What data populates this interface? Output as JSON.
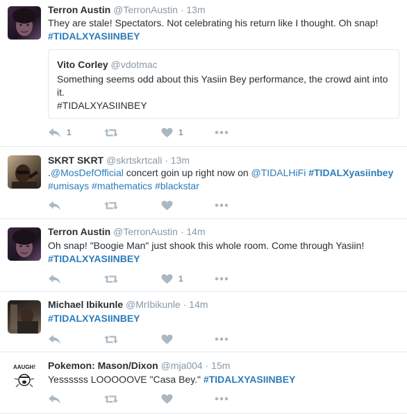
{
  "tweets": [
    {
      "name": "Terron Austin",
      "handle": "@TerronAustin",
      "sep": "·",
      "time": "13m",
      "text": "They are stale! Spectators. Not celebrating his return like I thought. Oh snap!",
      "hashtag": "#TIDALXYASIINBEY",
      "quote": {
        "name": "Vito Corley",
        "handle": "@vdotmac",
        "line1": "Something seems odd about this Yasiin Bey performance, the crowd aint into it.",
        "line2": "#TIDALXYASIINBEY"
      },
      "retweet_count": "1",
      "like_count": "1"
    },
    {
      "name": "SKRT SKRT",
      "handle": "@skrtskrtcali",
      "sep": "·",
      "time": "13m",
      "text_pre": ".",
      "mention1": "@MosDefOfficial",
      "text_mid": " concert goin up right now on ",
      "mention2": "@TIDALHiFi",
      "hashtag": "#TIDALXyasiinbey",
      "hashtags2": [
        "#umisays",
        "#mathematics",
        "#blackstar"
      ]
    },
    {
      "name": "Terron Austin",
      "handle": "@TerronAustin",
      "sep": "·",
      "time": "14m",
      "text": "Oh snap! \"Boogie Man\" just shook this whole room. Come through Yasiin!",
      "hashtag": "#TIDALXYASIINBEY",
      "like_count": "1"
    },
    {
      "name": "Michael Ibikunle",
      "handle": "@MrIbikunle",
      "sep": "·",
      "time": "14m",
      "hashtag": "#TIDALXYASIINBEY"
    },
    {
      "name": "Pokemon: Mason/Dixon",
      "handle": "@mja004",
      "sep": "·",
      "time": "15m",
      "text": "Yessssss LOOOOOVE \"Casa Bey.\"",
      "hashtag": "#TIDALXYASIINBEY",
      "avatar_text": "AAUGH!"
    }
  ],
  "icons": [
    "reply-icon",
    "retweet-icon",
    "like-icon",
    "more-icon"
  ],
  "colors": {
    "link": "#2b7bb9",
    "text": "#292f33",
    "muted": "#8899a6",
    "icon": "#aab8c2",
    "divider": "#e1e8ed"
  }
}
